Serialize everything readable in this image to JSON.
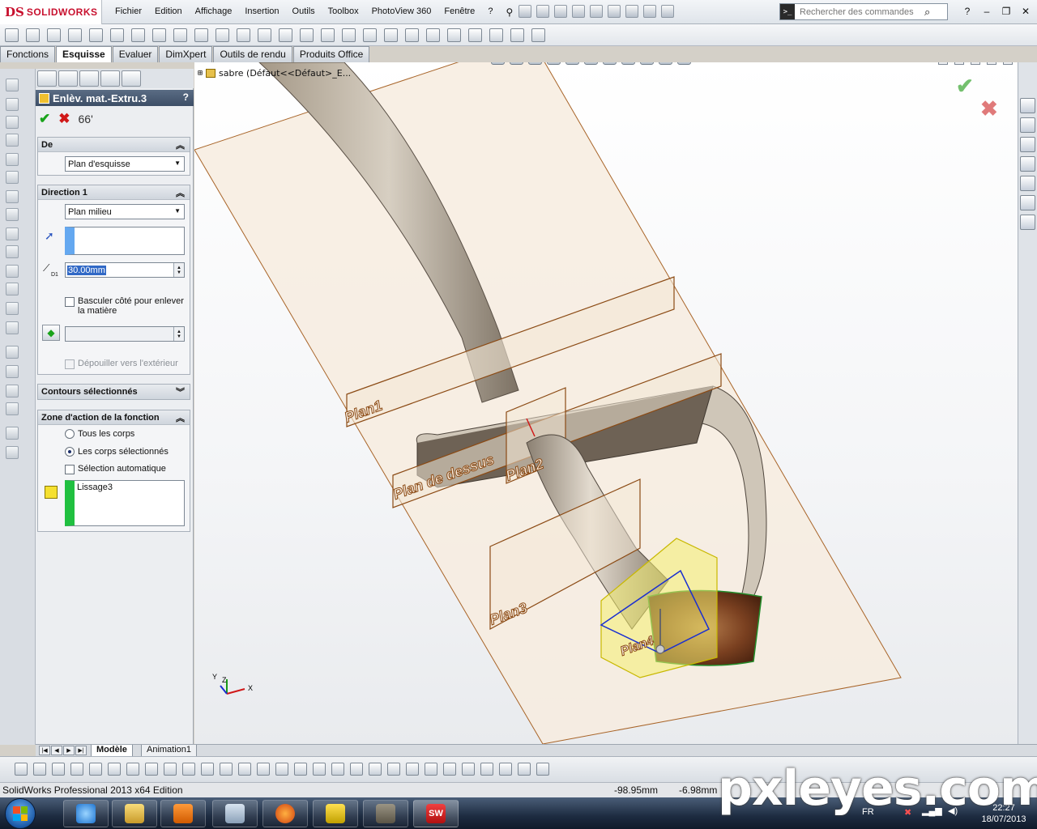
{
  "app": {
    "logo_mark": "DS",
    "logo_text": "SOLIDWORKS"
  },
  "menu": {
    "items": [
      "Fichier",
      "Edition",
      "Affichage",
      "Insertion",
      "Outils",
      "Toolbox",
      "PhotoView 360",
      "Fenêtre",
      "?"
    ],
    "pin_icon": "pushpin-icon"
  },
  "search": {
    "placeholder": "Rechercher des commandes",
    "icon": "magnifier-icon"
  },
  "command_manager": {
    "tabs": [
      "Fonctions",
      "Esquisse",
      "Evaluer",
      "DimXpert",
      "Outils de rendu",
      "Produits Office"
    ],
    "active_tab": "Esquisse"
  },
  "property_manager": {
    "title": "Enlèv. mat.-Extru.3",
    "help": "?",
    "ok_symbol": "✔",
    "cancel_symbol": "✖",
    "preview_symbol": "66'",
    "groups": {
      "de": {
        "title": "De",
        "start_condition": "Plan d'esquisse"
      },
      "direction1": {
        "title": "Direction 1",
        "end_condition": "Plan milieu",
        "depth_value": "30.00mm",
        "depth_label": "D1",
        "flip_side_label": "Basculer côté pour enlever la matière",
        "draft_outward_label": "Dépouiller vers l'extérieur"
      },
      "contours": {
        "title": "Contours sélectionnés"
      },
      "feature_scope": {
        "title": "Zone d'action de la fonction",
        "option_all": "Tous les corps",
        "option_selected": "Les corps sélectionnés",
        "selected_option": "Les corps sélectionnés",
        "auto_select_label": "Sélection automatique",
        "bodies": [
          "Lissage3"
        ]
      }
    }
  },
  "tree": {
    "expand": "⊞",
    "text": "sabre  (Défaut<<Défaut>_E..."
  },
  "viewport": {
    "accept_symbol": "✔",
    "reject_symbol": "✖",
    "plane_labels": [
      "Plan1",
      "Plan de dessus",
      "Plan2",
      "Plan3",
      "Plan4"
    ],
    "triad_labels": {
      "x": "X",
      "y": "Y",
      "z": "Z"
    }
  },
  "bottom_tabs": {
    "tabs": [
      "Modèle",
      "Animation1"
    ],
    "active": "Modèle"
  },
  "status": {
    "text": "SolidWorks Professional 2013 x64 Edition",
    "x": "-98.95mm",
    "y": "-6.98mm"
  },
  "watermark": "pxleyes.com",
  "taskbar": {
    "language": "FR",
    "time": "22:27",
    "date": "18/07/2013"
  },
  "colors": {
    "accent_red": "#c8102e",
    "ok_green": "#19a31b",
    "cancel_red": "#d01818",
    "plane_brown": "#8b4a14",
    "selection_yellow": "#f4ee70"
  }
}
